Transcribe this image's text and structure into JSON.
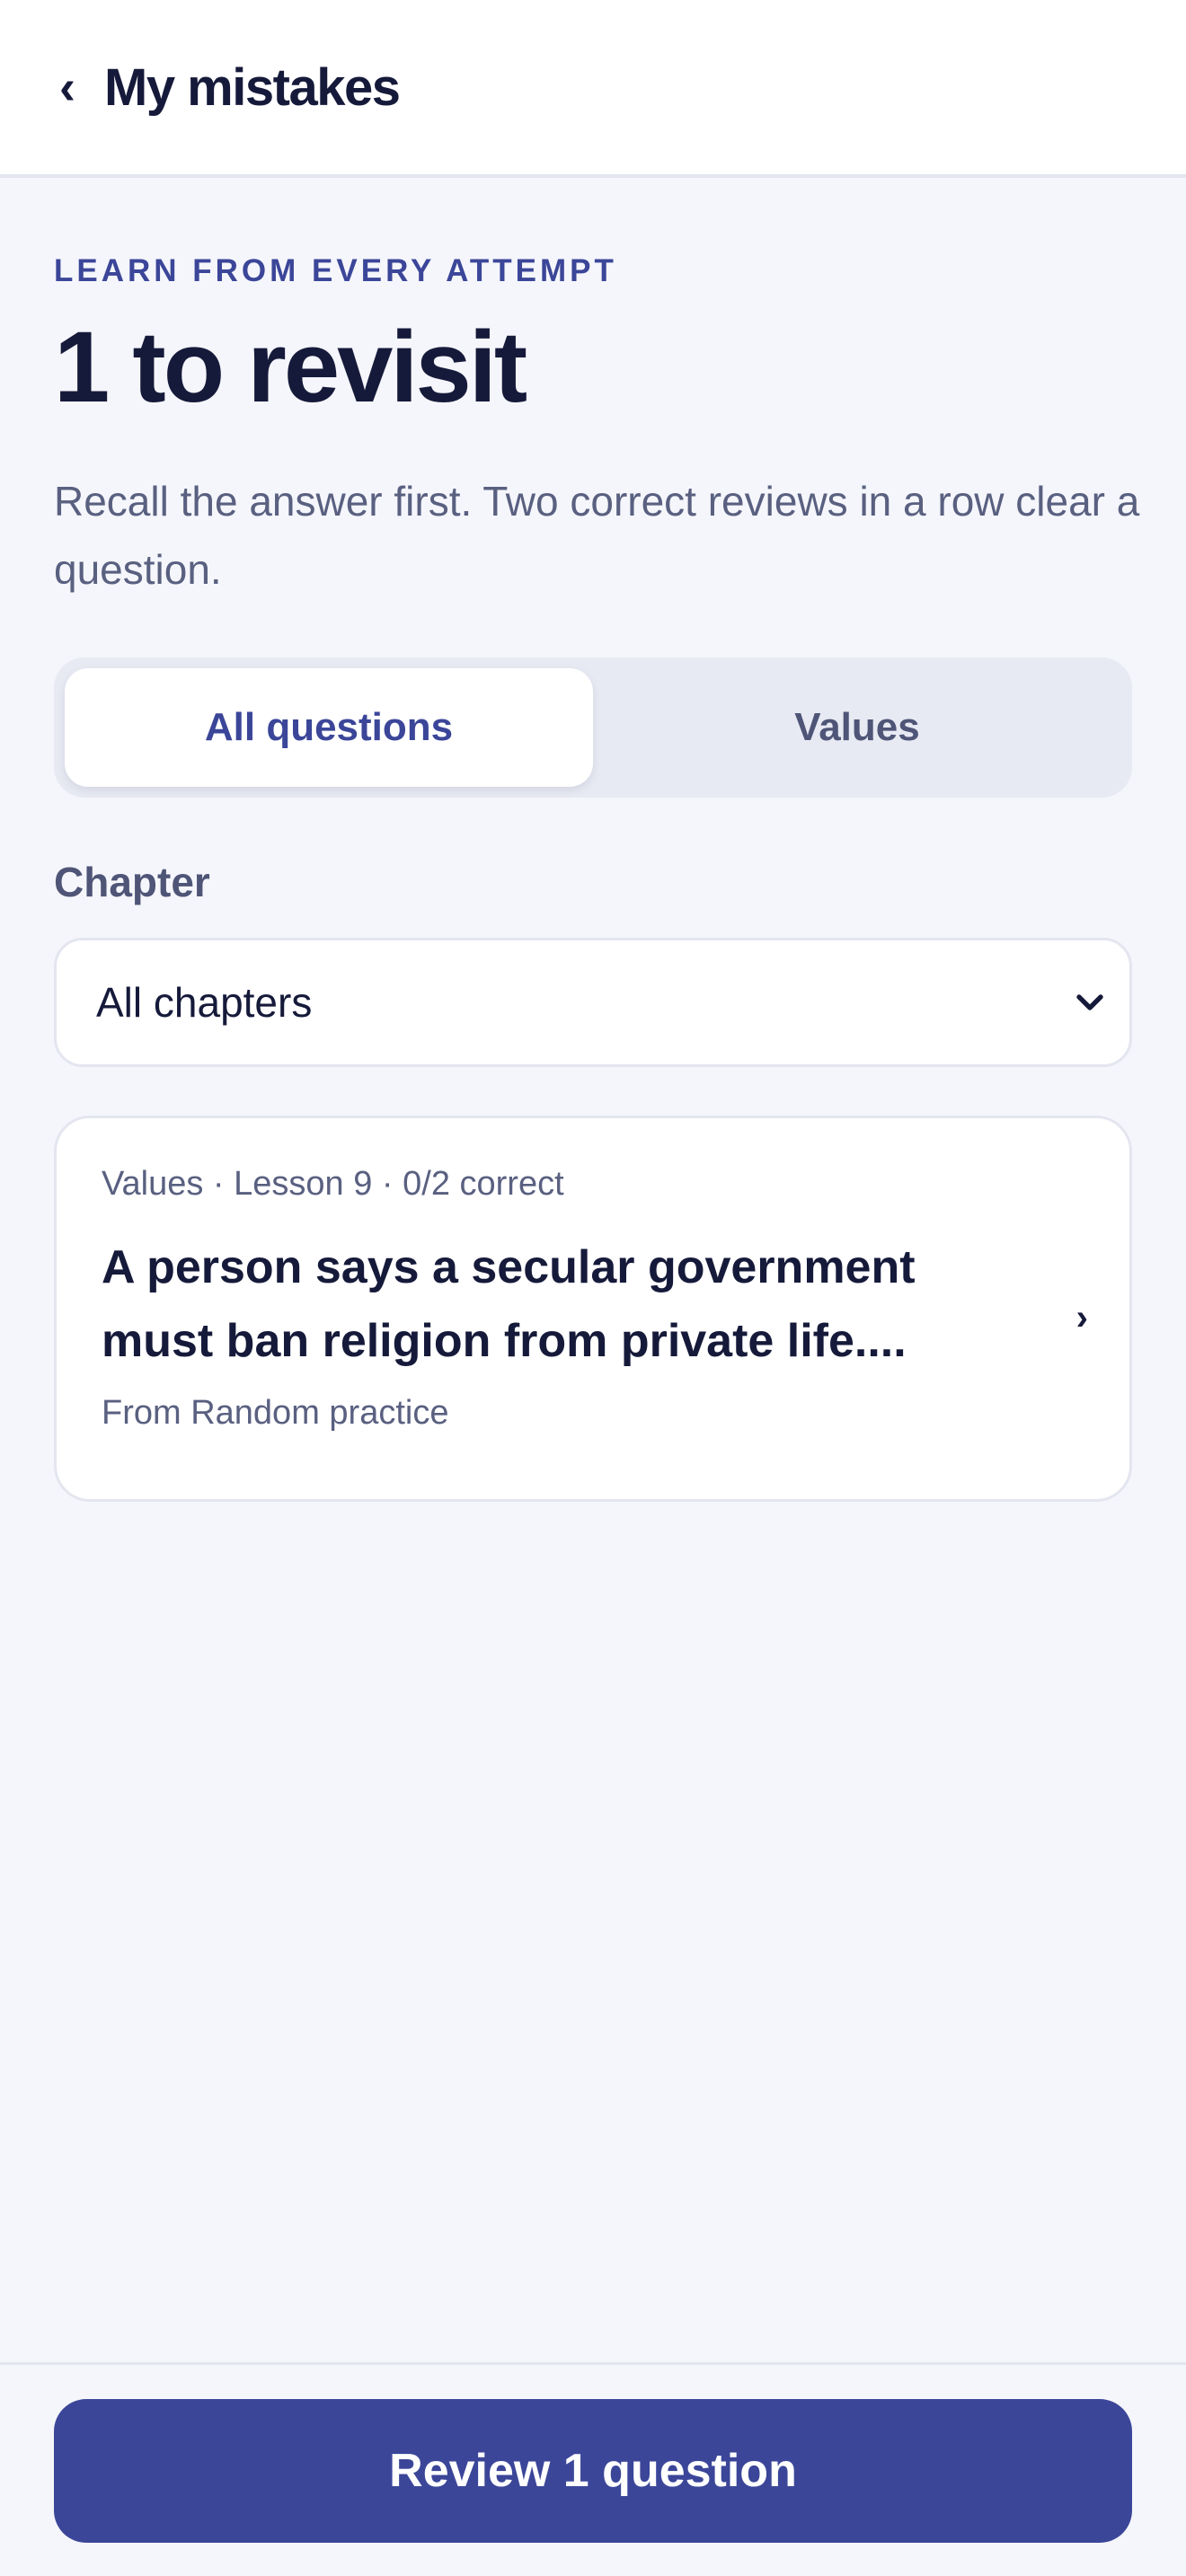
{
  "header": {
    "back_glyph": "‹",
    "title": "My mistakes"
  },
  "hero": {
    "eyebrow": "LEARN FROM EVERY ATTEMPT",
    "title": "1 to revisit",
    "subtitle": "Recall the answer first. Two correct reviews in a row clear a question."
  },
  "tabs": [
    {
      "label": "All questions",
      "active": true
    },
    {
      "label": "Values",
      "active": false
    }
  ],
  "filter": {
    "label": "Chapter",
    "selected": "All chapters"
  },
  "mistakes": [
    {
      "meta": "Values · Lesson 9 · 0/2 correct",
      "question": "A person says a secular government must ban religion from private life....",
      "source": "From Random practice",
      "arrow": "›"
    }
  ],
  "footer": {
    "cta_label": "Review 1 question"
  },
  "colors": {
    "accent": "#3b4699",
    "text_dark": "#161a3a",
    "text_muted": "#596080",
    "background": "#f5f6fb"
  },
  "icons": {
    "back": "chevron-left-icon",
    "select": "chevron-down-icon",
    "card": "chevron-right-icon"
  }
}
